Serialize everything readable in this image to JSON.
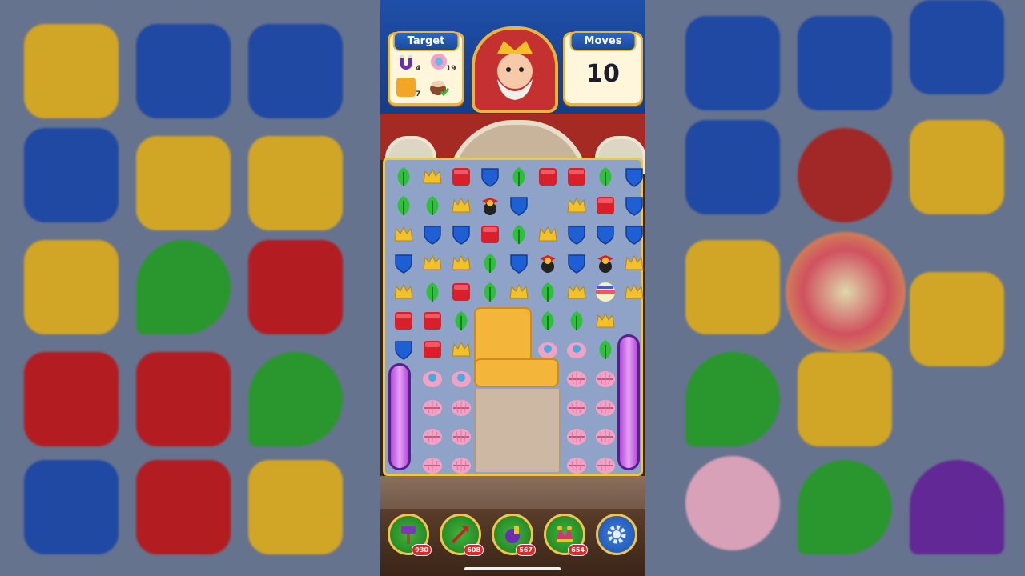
{
  "hud": {
    "target_title": "Target",
    "moves_title": "Moves",
    "moves_left": "10",
    "targets": [
      {
        "icon": "magnet-icon",
        "count": "4"
      },
      {
        "icon": "pearl-shell-icon",
        "count": "19"
      },
      {
        "icon": "orange-tile-icon",
        "count": "7"
      },
      {
        "icon": "pot-icon",
        "count": "done"
      }
    ]
  },
  "avatar": {
    "icon": "king-avatar-icon"
  },
  "colors": {
    "green": "#2fbf3a",
    "yellow": "#f2c12a",
    "red": "#d81f2a",
    "blue": "#1f5fd6",
    "pink": "#f2a3c5",
    "orange": "#f3b53a",
    "frame": "#f1c34f"
  },
  "board": {
    "rows": [
      [
        "leaf",
        "crown",
        "box",
        "shield",
        "leaf",
        "box",
        "box",
        "leaf",
        "shield"
      ],
      [
        "leaf",
        "leaf",
        "crown",
        "propeller",
        "shield",
        "",
        "crown",
        "box",
        "shield"
      ],
      [
        "crown",
        "shield",
        "shield",
        "box",
        "leaf",
        "crown",
        "shield",
        "shield",
        "shield"
      ],
      [
        "shield",
        "crown",
        "crown",
        "leaf",
        "shield",
        "propeller",
        "shield",
        "propeller",
        "crown"
      ],
      [
        "crown",
        "leaf",
        "box",
        "leaf",
        "crown",
        "leaf",
        "crown",
        "rocket",
        "crown"
      ],
      [
        "box",
        "box",
        "leaf",
        "",
        "",
        "leaf",
        "leaf",
        "crown",
        ""
      ],
      [
        "shield",
        "box",
        "crown",
        "",
        "",
        "pearl",
        "pearl",
        "leaf",
        ""
      ],
      [
        "",
        "pearl",
        "pearl",
        "",
        "",
        "",
        "shell",
        "shell",
        ""
      ],
      [
        "",
        "shell",
        "shell",
        "",
        "",
        "",
        "shell",
        "shell",
        ""
      ],
      [
        "",
        "shell",
        "shell",
        "",
        "",
        "",
        "shell",
        "shell",
        ""
      ],
      [
        "",
        "shell",
        "shell",
        "",
        "",
        "",
        "shell",
        "shell",
        ""
      ]
    ]
  },
  "boosters": [
    {
      "name": "hammer",
      "icon": "hammer-icon",
      "count": "930"
    },
    {
      "name": "arrow",
      "icon": "arrow-icon",
      "count": "608"
    },
    {
      "name": "cannon",
      "icon": "cannon-icon",
      "count": "567"
    },
    {
      "name": "jester",
      "icon": "jester-hat-icon",
      "count": "654"
    },
    {
      "name": "settings",
      "icon": "gear-icon"
    }
  ]
}
